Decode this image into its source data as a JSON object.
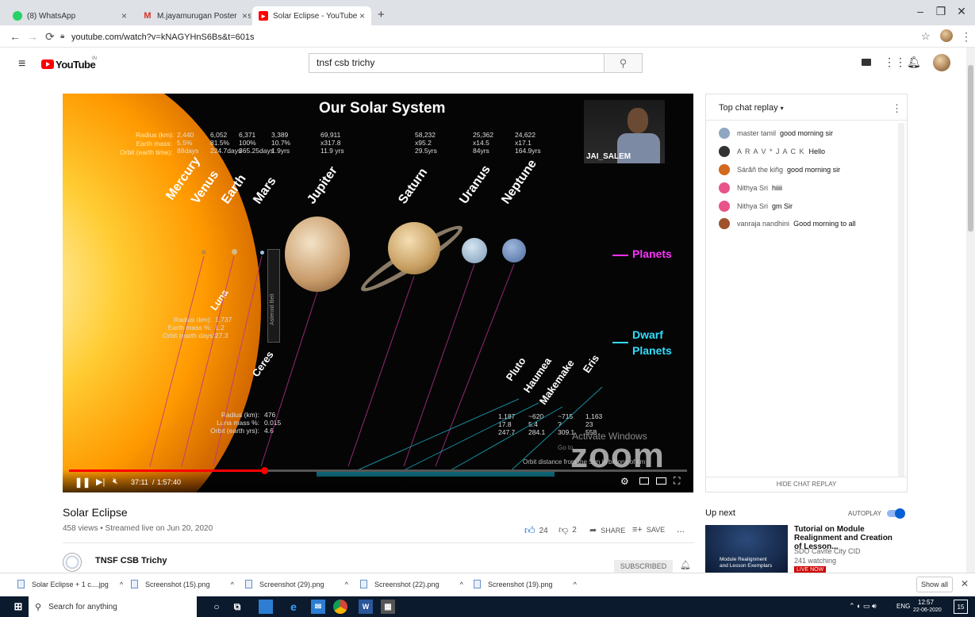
{
  "browser": {
    "tabs": [
      {
        "label": "(8) WhatsApp",
        "icon": "whatsapp-icon",
        "color": "#25d366"
      },
      {
        "label": "M.jayamurugan Poster designs",
        "icon": "gmail-icon",
        "color": "#d93025"
      },
      {
        "label": "Solar Eclipse - YouTube",
        "icon": "youtube-icon",
        "color": "#ff0000"
      }
    ],
    "new_tab": "+",
    "url": "youtube.com/watch?v=kNAGYHnS6Bs&t=601s"
  },
  "youtube": {
    "logo_text": "YouTube",
    "logo_sup": "IN",
    "search_value": "tnsf csb trichy",
    "search_placeholder": "Search"
  },
  "video": {
    "title": "Our Solar System",
    "presenter_label": "JAI_SALEM",
    "planets": [
      "Mercury",
      "Venus",
      "Earth",
      "Mars",
      "Jupiter",
      "Saturn",
      "Uranus",
      "Neptune"
    ],
    "dwarfs": [
      "Pluto",
      "Haumea",
      "Makemake",
      "Eris"
    ],
    "stats_labels": [
      "Radius (km):",
      "Earth mass:",
      "Orbit (earth time):"
    ],
    "stats_inner": [
      [
        "2,440",
        "5.5%",
        "88days"
      ],
      [
        "6,052",
        "81.5%",
        "224.7days"
      ],
      [
        "6,371",
        "100%",
        "365.25days"
      ],
      [
        "3,389",
        "10.7%",
        "1.9yrs"
      ],
      [
        "69,911",
        "x317.8",
        "11.9 yrs"
      ],
      [
        "58,232",
        "x95.2",
        "29.5yrs"
      ],
      [
        "25,362",
        "x14.5",
        "84yrs"
      ],
      [
        "24,622",
        "x17.1",
        "164.9yrs"
      ]
    ],
    "luna": {
      "name": "Luna",
      "radius_label": "Radius (km):",
      "radius": "1,737",
      "mass_label": "Earth mass %:",
      "mass": "1.2",
      "orbit_label": "Orbit (earth days):",
      "orbit": "27.3"
    },
    "ceres": {
      "name": "Ceres",
      "radius_label": "Radius (km):",
      "radius": "476",
      "mass_label": "Luna mass %:",
      "mass": "0.015",
      "orbit_label": "Orbit (earth yrs):",
      "orbit": "4.6"
    },
    "dwarf_stats": [
      [
        "1,187",
        "17.8",
        "247.7"
      ],
      [
        "~620",
        "5.4",
        "284.1"
      ],
      [
        "~715",
        "?",
        "309.1"
      ],
      [
        "1,163",
        "23",
        "558"
      ]
    ],
    "asteroid_belt": "Asteroid Belt",
    "planets_label": "Planets",
    "dwarf_label_1": "Dwarf",
    "dwarf_label_2": "Planets",
    "orbit_distance": "Orbit distance from the Sun in billions of km",
    "watermark_1": "Activate Windows",
    "watermark_2": "Go to",
    "zoom_logo": "zoom",
    "time_current": "37:11",
    "time_total": "1:57:40",
    "progress": 0.316
  },
  "meta": {
    "title": "Solar Eclipse",
    "stats": "458 views • Streamed live on Jun 20, 2020",
    "likes": "24",
    "dislikes": "2",
    "share": "SHARE",
    "save": "SAVE",
    "more": "...",
    "channel": "TNSF CSB Trichy",
    "subscribe": "SUBSCRIBED"
  },
  "chat": {
    "header": "Top chat replay",
    "messages": [
      {
        "author": "master tamil",
        "text": "good morning sir",
        "color": "#8fa7c2"
      },
      {
        "author": "A R A V * J A C K",
        "text": "Hello",
        "color": "#333333"
      },
      {
        "author": "Sárãñ the kiñg",
        "text": "good morning sir",
        "color": "#d2691e"
      },
      {
        "author": "Nithya Sri",
        "text": "hiiii",
        "color": "#e8548a"
      },
      {
        "author": "Nithya Sri",
        "text": "gm Sir",
        "color": "#e8548a"
      },
      {
        "author": "vanraja nandhini",
        "text": "Good morning to all",
        "color": "#a0522d"
      }
    ],
    "hide_label": "HIDE CHAT REPLAY"
  },
  "upnext": {
    "label": "Up next",
    "autoplay": "AUTOPLAY",
    "video_title": "Tutorial on Module Realignment and Creation of Lesson...",
    "channel": "SDO Cavite City CID",
    "watching": "241 watching",
    "thumb_text_1": "Module Realignment",
    "thumb_text_2": "and Lesson Exemplars",
    "live_badge": "LIVE NOW"
  },
  "downloads": {
    "files": [
      "Solar Eclipse + 1 c....jpg",
      "Screenshot (15).png",
      "Screenshot (29).png",
      "Screenshot (22).png",
      "Screenshot (19).png"
    ],
    "show_all": "Show all"
  },
  "taskbar": {
    "search": "Search for anything",
    "lang": "ENG",
    "time": "12:57",
    "date": "22-06-2020",
    "notif": "15"
  }
}
